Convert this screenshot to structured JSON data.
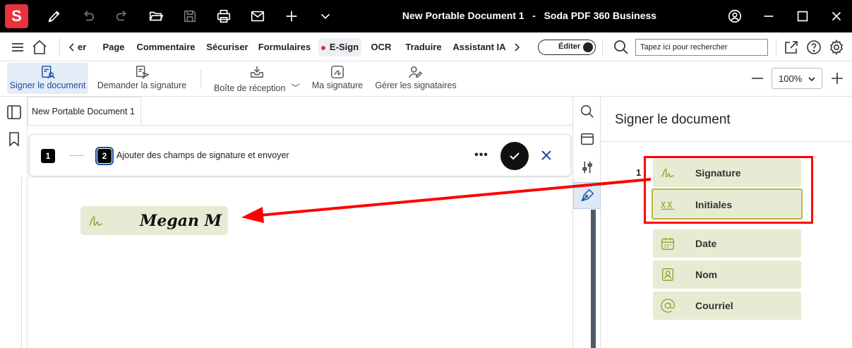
{
  "app": {
    "logo_letter": "S",
    "window_title": "New Portable Document 1   -   Soda PDF 360 Business"
  },
  "menubar": {
    "items": [
      {
        "label": "er"
      },
      {
        "label": "Page"
      },
      {
        "label": "Commentaire"
      },
      {
        "label": "Sécuriser"
      },
      {
        "label": "Formulaires"
      },
      {
        "label": "E-Sign"
      },
      {
        "label": "OCR"
      },
      {
        "label": "Traduire"
      },
      {
        "label": "Assistant IA"
      }
    ],
    "edit_toggle_label": "Éditer",
    "search_placeholder": "Tapez ici pour rechercher"
  },
  "ribbon": {
    "sign_document": "Signer le document",
    "request_signature": "Demander la signature",
    "inbox": "Boîte de réception",
    "my_signature": "Ma signature",
    "manage_signers": "Gérer les signataires",
    "zoom": "100%"
  },
  "document": {
    "tab_label": "New Portable Document 1",
    "step1_number": "1",
    "step2_number": "2",
    "step2_label": "Ajouter des champs de signature et envoyer",
    "more_label": "•••",
    "signature_name": "Megan M"
  },
  "panel": {
    "title": "Signer le document",
    "field_index": "1",
    "fields": [
      {
        "label": "Signature",
        "icon": "signature-icon"
      },
      {
        "label": "Initiales",
        "icon": "initials-icon"
      },
      {
        "label": "Date",
        "icon": "calendar-icon"
      },
      {
        "label": "Nom",
        "icon": "id-card-icon"
      },
      {
        "label": "Courriel",
        "icon": "at-icon"
      }
    ]
  },
  "colors": {
    "titlebar": "#000000",
    "logo": "#e8333c",
    "field_bg": "#e8ebd4",
    "field_icon": "#9aa63a",
    "highlight": "#ff0000",
    "accent_blue": "#1a4fa0"
  }
}
